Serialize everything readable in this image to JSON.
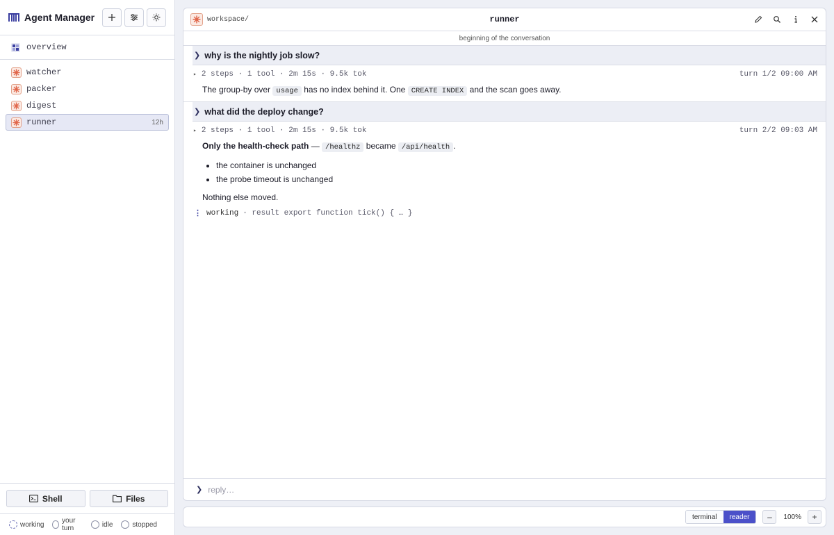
{
  "sidebar": {
    "title": "Agent Manager",
    "overview_label": "overview",
    "agents": [
      {
        "label": "watcher",
        "meta": ""
      },
      {
        "label": "packer",
        "meta": ""
      },
      {
        "label": "digest",
        "meta": ""
      },
      {
        "label": "runner",
        "meta": "12h",
        "active": true
      }
    ],
    "shell_label": "Shell",
    "files_label": "Files",
    "legend": {
      "working": "working",
      "your_turn": "your turn",
      "idle": "idle",
      "stopped": "stopped"
    }
  },
  "main": {
    "breadcrumb": "workspace/",
    "title": "runner",
    "conversation_start": "beginning of the conversation",
    "turns": [
      {
        "question": "why is the nightly job slow?",
        "meta": "2 steps · 1 tool · 2m 15s · 9.5k tok",
        "turn": "turn 1/2 09:00 AM",
        "answer": {
          "t1": "The group-by over ",
          "c1": "usage",
          "t2": " has no index behind it. One ",
          "c2": "CREATE INDEX",
          "t3": " and the scan goes away."
        }
      },
      {
        "question": "what did the deploy change?",
        "meta": "2 steps · 1 tool · 2m 15s · 9.5k tok",
        "turn": "turn 2/2 09:03 AM",
        "answer": {
          "bold": "Only the health-check path",
          "t1": " — ",
          "c1": "/healthz",
          "t2": " became ",
          "c2": "/api/health",
          "t3": ".",
          "bullets": [
            "the container is unchanged",
            "the probe timeout is unchanged"
          ],
          "closing": "Nothing else moved."
        }
      }
    ],
    "working_label": "working",
    "working_detail": "· result export function tick() { … }",
    "reply_placeholder": "reply…"
  },
  "toolbar": {
    "terminal_label": "terminal",
    "reader_label": "reader",
    "zoom_out": "–",
    "zoom_level": "100%",
    "zoom_in": "+"
  },
  "colors": {
    "accent": "#4b50c9",
    "agent_icon": "#e0664a",
    "question_bg": "#eceef5"
  }
}
